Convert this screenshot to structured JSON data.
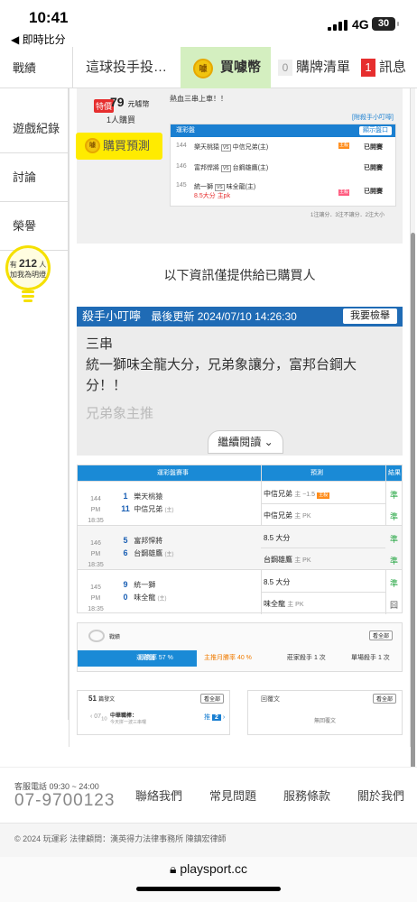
{
  "status": {
    "time": "10:41",
    "back": "◀ 即時比分",
    "network": "4G",
    "battery": "30"
  },
  "tabs": {
    "pitcher": "這球投手投…",
    "buy_coins": "買噱幣",
    "coin_icon": "噱",
    "purchase_count": "0",
    "purchase_list": "購牌清單",
    "msg_count": "1",
    "messages": "訊息"
  },
  "sidebar": {
    "items": [
      "戰績",
      "遊戲紀錄",
      "討論",
      "榮譽"
    ],
    "bulb_prefix": "有",
    "bulb_count": "212",
    "bulb_suffix": "人",
    "bulb_note": "加我為明燈"
  },
  "purchase": {
    "tag": "特價",
    "coins": "79",
    "coins_unit": "元噱幣",
    "buyers": "1人購買",
    "note": "熱血三串上車！！",
    "button": "購買預測",
    "tips_link": "[附殺手小叮嚀]",
    "table_title": "運彩盤",
    "show_btn": "顯示盤口",
    "rows": [
      {
        "no": "144",
        "away": "樂天桃猿",
        "home": "中信兄弟(主)",
        "badge": "主殺",
        "status": "已開賽"
      },
      {
        "no": "146",
        "away": "富邦悍將",
        "home": "台鋼雄鷹(主)",
        "status": "已開賽"
      },
      {
        "no": "145",
        "away": "統一獅",
        "home": "味全龍(主)",
        "line1": "8.5大分",
        "line2": "主pk",
        "badge": "主殺",
        "status": "已開賽"
      }
    ],
    "footnote": "1注讓分．3注不讓分．2注大小"
  },
  "info_text": "以下資訊僅提供給已購買人",
  "killer": {
    "title": "殺手小叮嚀",
    "updated_label": "最後更新",
    "updated_time": "2024/07/10 14:26:30",
    "report_btn": "我要檢舉",
    "body_l1": "三串",
    "body_l2": "統一獅味全龍大分，兄弟象讓分，富邦台鋼大",
    "body_l3": "分！！",
    "body_l4": "兄弟象主推",
    "read_more": "繼續閱讀 ⌄"
  },
  "games": {
    "headers": {
      "match": "運彩盤賽事",
      "prediction": "預測",
      "result": "結果"
    },
    "rows": [
      {
        "no": "144",
        "time": "PM 18:35",
        "away_no": "1",
        "away": "樂天桃猿",
        "home_no": "11",
        "home": "中信兄弟",
        "home_tag": "(主)",
        "p1": "中信兄弟",
        "p1_sub": "主 −1.5",
        "p1_badge": "主殺",
        "r1": "準",
        "p2": "中信兄弟",
        "p2_sub": "主 PK",
        "r2": "準"
      },
      {
        "no": "146",
        "time": "PM 18:35",
        "away_no": "5",
        "away": "富邦悍將",
        "home_no": "6",
        "home": "台鋼雄鷹",
        "home_tag": "(主)",
        "p1": "8.5 大分",
        "p1_sub": "",
        "r1": "準",
        "p2": "台鋼雄鷹",
        "p2_sub": "主 PK",
        "r2": "準"
      },
      {
        "no": "145",
        "time": "PM 18:35",
        "away_no": "9",
        "away": "統一獅",
        "home_no": "0",
        "home": "味全龍",
        "home_tag": "(主)",
        "p1": "8.5 大分",
        "p1_sub": "",
        "r1": "準",
        "p2": "味全龍",
        "p2_sub": "主 PK",
        "r2": "囧"
      }
    ]
  },
  "record": {
    "label": "戰績",
    "all": "看全部",
    "tab_active": "運彩盤",
    "month_win": "月勝率 57 %",
    "home_month_win": "主推月勝率 40 %",
    "killer_count": "莊家殺手 1 次",
    "single_killer": "單場殺手 1 次"
  },
  "posts": {
    "count": "51",
    "count_label": "篇發文",
    "all": "看全部",
    "date_m": "07",
    "date_d": "10",
    "title": "中華職棒：",
    "desc": "今天拼一波三串囉",
    "push_label": "推",
    "push_count": "2",
    "reply_label": "回覆文",
    "reply_all": "看全部",
    "reply_none": "無回覆文"
  },
  "footer": {
    "tel_label": "客服電話 09:30 ~ 24:00",
    "tel": "07-9700123",
    "links": [
      "聯絡我們",
      "常見問題",
      "服務條款",
      "關於我們"
    ],
    "copyright": "© 2024 玩運彩 法律顧問：漢英得力法律事務所 陳鎮宏律師",
    "url": "playsport.cc"
  }
}
